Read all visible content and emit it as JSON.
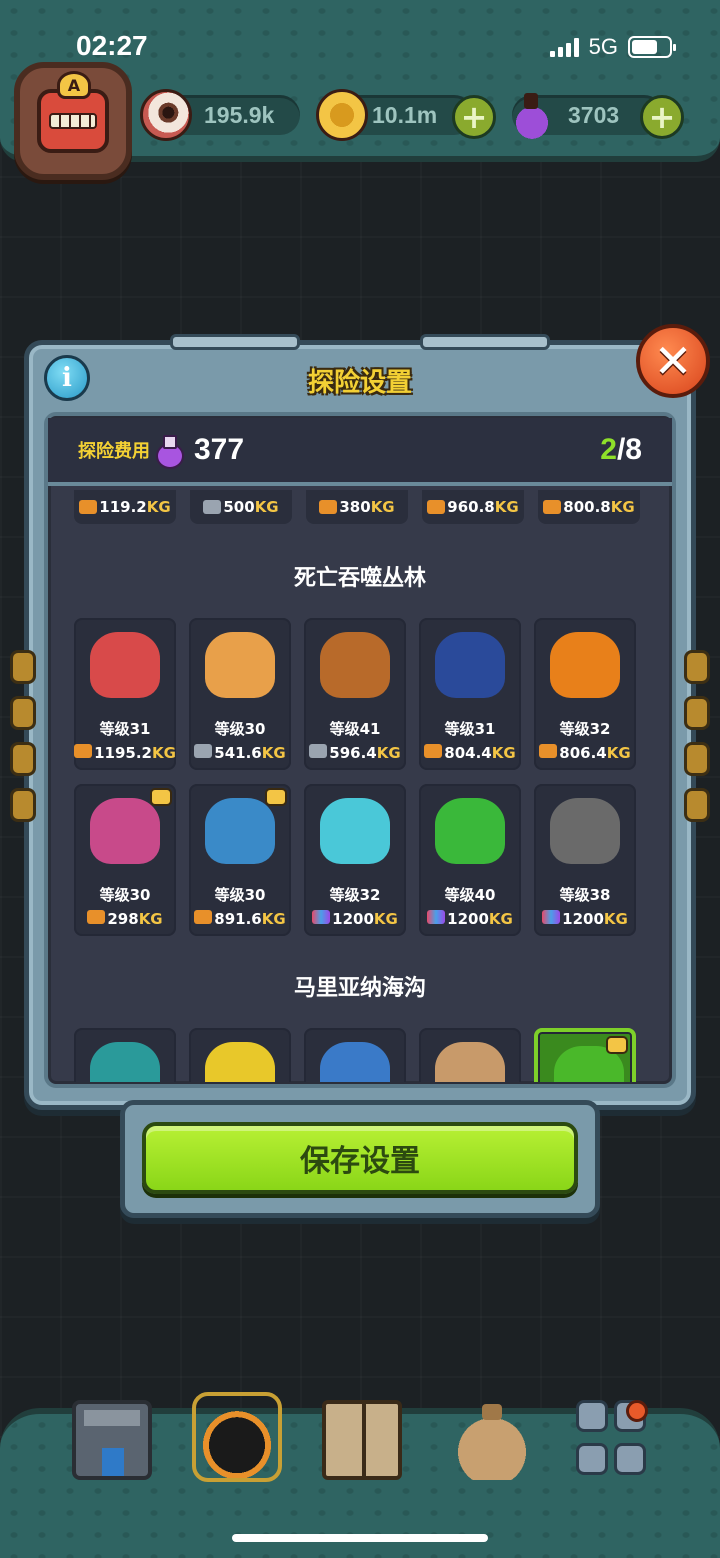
{
  "status_bar": {
    "time": "02:27",
    "network": "5G"
  },
  "resources": [
    {
      "icon": "eye-icon",
      "value": "195.9k",
      "has_plus": false
    },
    {
      "icon": "coin-icon",
      "value": "10.1m",
      "has_plus": true
    },
    {
      "icon": "potion-icon",
      "value": "3703",
      "has_plus": true
    }
  ],
  "avatar": {
    "badge": "A"
  },
  "modal": {
    "title": "探险设置",
    "info_label": "i",
    "close_label": "✕",
    "cost_label": "探险费用",
    "cost_value": "377",
    "slots_used": "2",
    "slots_total": "/8"
  },
  "prev_row": [
    {
      "value": "119.2",
      "unit": "KG",
      "tag": "kg-gold"
    },
    {
      "value": "500",
      "unit": "KG",
      "tag": "kg-grey"
    },
    {
      "value": "380",
      "unit": "KG",
      "tag": "kg-gold"
    },
    {
      "value": "960.8",
      "unit": "KG",
      "tag": "kg-gold"
    },
    {
      "value": "800.8",
      "unit": "KG",
      "tag": "kg-gold"
    }
  ],
  "regions": [
    {
      "name": "死亡吞噬丛林",
      "creatures": [
        {
          "level": "等级31",
          "weight": "1195.2",
          "unit": "KG",
          "tag": "kg-gold",
          "color": "#d84a4a",
          "badge": false
        },
        {
          "level": "等级30",
          "weight": "541.6",
          "unit": "KG",
          "tag": "kg-grey",
          "color": "#e8a04a",
          "badge": false
        },
        {
          "level": "等级41",
          "weight": "596.4",
          "unit": "KG",
          "tag": "kg-grey",
          "color": "#b86a2a",
          "badge": false
        },
        {
          "level": "等级31",
          "weight": "804.4",
          "unit": "KG",
          "tag": "kg-gold",
          "color": "#2a4a9a",
          "badge": false
        },
        {
          "level": "等级32",
          "weight": "806.4",
          "unit": "KG",
          "tag": "kg-gold",
          "color": "#e8801a",
          "badge": false
        },
        {
          "level": "等级30",
          "weight": "298",
          "unit": "KG",
          "tag": "kg-gold",
          "color": "#c84a8a",
          "badge": true
        },
        {
          "level": "等级30",
          "weight": "891.6",
          "unit": "KG",
          "tag": "kg-gold",
          "color": "#3a8ac8",
          "badge": true
        },
        {
          "level": "等级32",
          "weight": "1200",
          "unit": "KG",
          "tag": "kg-rain",
          "color": "#4ac8d8",
          "badge": false
        },
        {
          "level": "等级40",
          "weight": "1200",
          "unit": "KG",
          "tag": "kg-rain",
          "color": "#3ab83a",
          "badge": false
        },
        {
          "level": "等级38",
          "weight": "1200",
          "unit": "KG",
          "tag": "kg-rain",
          "color": "#6a6a6a",
          "badge": false
        }
      ]
    },
    {
      "name": "马里亚纳海沟",
      "creatures": [
        {
          "color": "#2a9a9a",
          "selected": false,
          "badge": false
        },
        {
          "color": "#e8c82a",
          "selected": false,
          "badge": false
        },
        {
          "color": "#3a7ac8",
          "selected": false,
          "badge": false
        },
        {
          "color": "#c89a6a",
          "selected": false,
          "badge": false
        },
        {
          "color": "#4ab82a",
          "selected": true,
          "badge": true
        }
      ]
    }
  ],
  "save_button": "保存设置",
  "colors": {
    "accent": "#8ad618",
    "title": "#f3d034",
    "panel": "#363a4a"
  }
}
